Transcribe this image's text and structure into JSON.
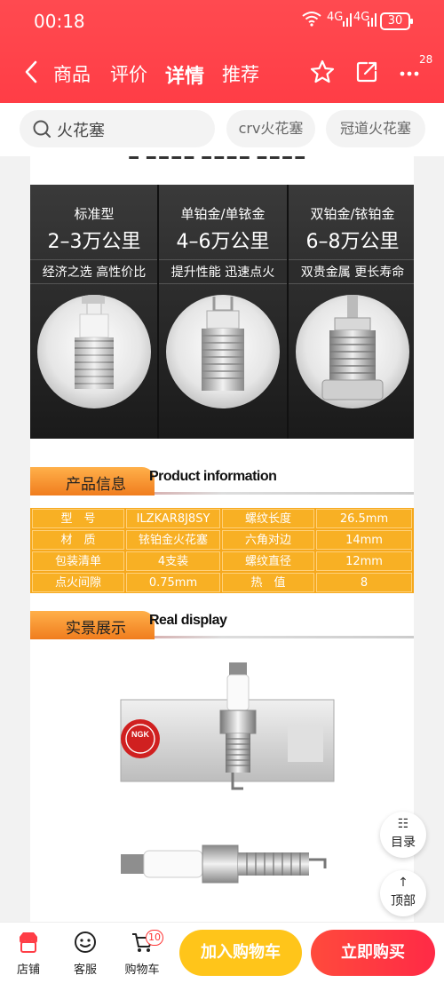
{
  "status": {
    "time": "00:18",
    "signal1": "4G",
    "signal2": "4G",
    "battery": "30"
  },
  "nav": {
    "tabs": [
      {
        "label": "商品"
      },
      {
        "label": "评价"
      },
      {
        "label": "详情",
        "selected": true
      },
      {
        "label": "推荐"
      }
    ],
    "more_badge": "28"
  },
  "search": {
    "query": "火花塞",
    "chips": [
      "crv火花塞",
      "冠道火花塞"
    ]
  },
  "detail": {
    "types": [
      {
        "name": "标准型",
        "mileage": "2–3万公里",
        "slogan": "经济之选 高性价比"
      },
      {
        "name": "单铂金/单铱金",
        "mileage": "4–6万公里",
        "slogan": "提升性能 迅速点火"
      },
      {
        "name": "双铂金/铱铂金",
        "mileage": "6–8万公里",
        "slogan": "双贵金属 更长寿命"
      }
    ],
    "product_section": {
      "cn": "产品信息",
      "en": "Product information"
    },
    "specs": [
      [
        "型　号",
        "ILZKAR8J8SY",
        "螺纹长度",
        "26.5mm"
      ],
      [
        "材　质",
        "铱铂金火花塞",
        "六角对边",
        "14mm"
      ],
      [
        "包装清单",
        "4支装",
        "螺纹直径",
        "12mm"
      ],
      [
        "点火间隙",
        "0.75mm",
        "热　值",
        "8"
      ]
    ],
    "display_section": {
      "cn": "实景展示",
      "en": "Real display"
    },
    "box_brand": "NGK"
  },
  "floating": {
    "catalog": "目录",
    "top": "顶部"
  },
  "bottom": {
    "shop": "店铺",
    "service": "客服",
    "cart": "购物车",
    "cart_count": "10",
    "add_to_cart": "加入购物车",
    "buy_now": "立即购买"
  },
  "colors": {
    "header_red": "#ff4047",
    "accent_orange": "#f6a81c",
    "cart_yellow": "#ffc51a",
    "buy_red": "#ff2d3c"
  }
}
